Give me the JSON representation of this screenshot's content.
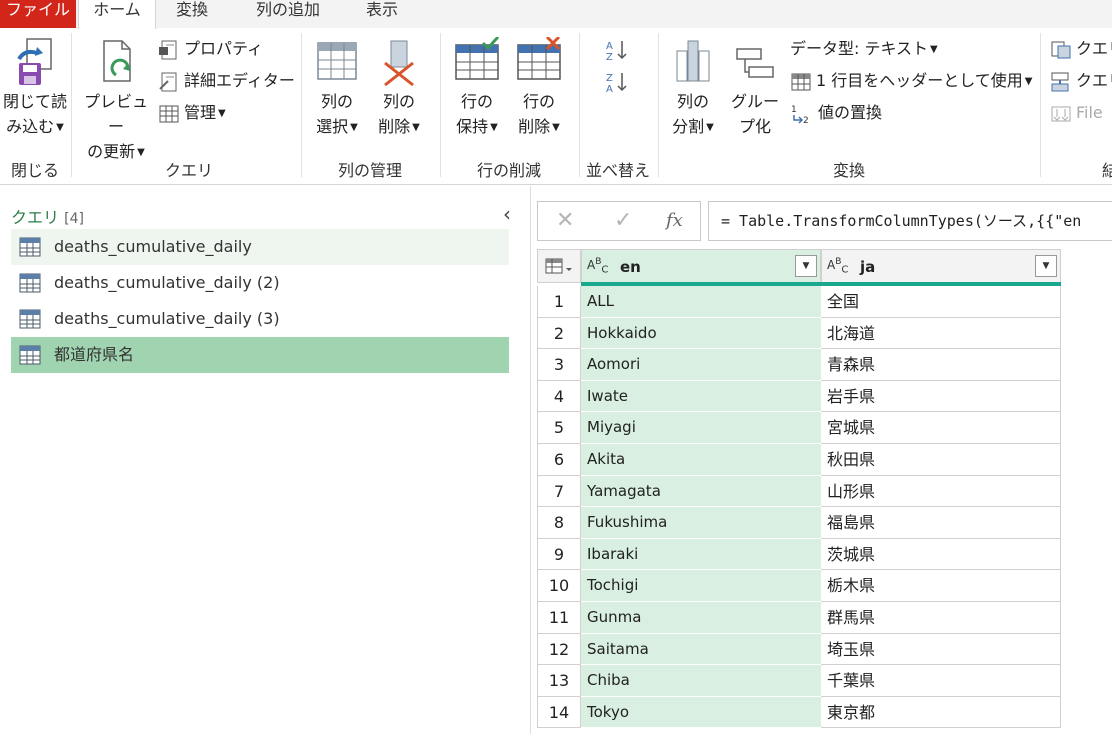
{
  "menu": {
    "file": "ファイル",
    "home": "ホーム",
    "transform": "変換",
    "add_column": "列の追加",
    "view": "表示"
  },
  "ribbon": {
    "close_load": [
      "閉じて読",
      "み込む"
    ],
    "close_group": "閉じる",
    "refresh_preview": [
      "プレビュー",
      "の更新"
    ],
    "properties": "プロパティ",
    "advanced_editor": "詳細エディター",
    "manage": "管理",
    "query_group": "クエリ",
    "choose_columns": [
      "列の",
      "選択"
    ],
    "remove_columns": [
      "列の",
      "削除"
    ],
    "manage_columns_group": "列の管理",
    "keep_rows": [
      "行の",
      "保持"
    ],
    "remove_rows": [
      "行の",
      "削除"
    ],
    "reduce_rows_group": "行の削減",
    "sort_group": "並べ替え",
    "split_column": [
      "列の",
      "分割"
    ],
    "group_by": [
      "グルー",
      "プ化"
    ],
    "data_type": "データ型: テキスト",
    "first_row_header": "1 行目をヘッダーとして使用",
    "replace_values": "値の置換",
    "transform_group": "変換",
    "right_item_1": "クエリ",
    "right_item_2": "クエリ",
    "right_item_3": "File",
    "right_group": "結"
  },
  "queries": {
    "title": "クエリ",
    "count": "[4]",
    "items": [
      "deaths_cumulative_daily",
      "deaths_cumulative_daily (2)",
      "deaths_cumulative_daily (3)",
      "都道府県名"
    ]
  },
  "formula_bar": {
    "cancel": "✕",
    "confirm": "✓",
    "fx": "fx",
    "formula": "= Table.TransformColumnTypes(ソース,{{\"en"
  },
  "grid": {
    "columns": [
      {
        "type_label": "ABC",
        "name": "en"
      },
      {
        "type_label": "ABC",
        "name": "ja"
      }
    ],
    "rows": [
      {
        "n": "1",
        "en": "ALL",
        "ja": "全国"
      },
      {
        "n": "2",
        "en": "Hokkaido",
        "ja": "北海道"
      },
      {
        "n": "3",
        "en": "Aomori",
        "ja": "青森県"
      },
      {
        "n": "4",
        "en": "Iwate",
        "ja": "岩手県"
      },
      {
        "n": "5",
        "en": "Miyagi",
        "ja": "宮城県"
      },
      {
        "n": "6",
        "en": "Akita",
        "ja": "秋田県"
      },
      {
        "n": "7",
        "en": "Yamagata",
        "ja": "山形県"
      },
      {
        "n": "8",
        "en": "Fukushima",
        "ja": "福島県"
      },
      {
        "n": "9",
        "en": "Ibaraki",
        "ja": "茨城県"
      },
      {
        "n": "10",
        "en": "Tochigi",
        "ja": "栃木県"
      },
      {
        "n": "11",
        "en": "Gunma",
        "ja": "群馬県"
      },
      {
        "n": "12",
        "en": "Saitama",
        "ja": "埼玉県"
      },
      {
        "n": "13",
        "en": "Chiba",
        "ja": "千葉県"
      },
      {
        "n": "14",
        "en": "Tokyo",
        "ja": "東京都"
      }
    ]
  },
  "colors": {
    "file_tab": "#d2261b",
    "selected_column": "#d8efe1",
    "selected_query": "#a0d4b0",
    "accent_teal": "#19a88e"
  }
}
